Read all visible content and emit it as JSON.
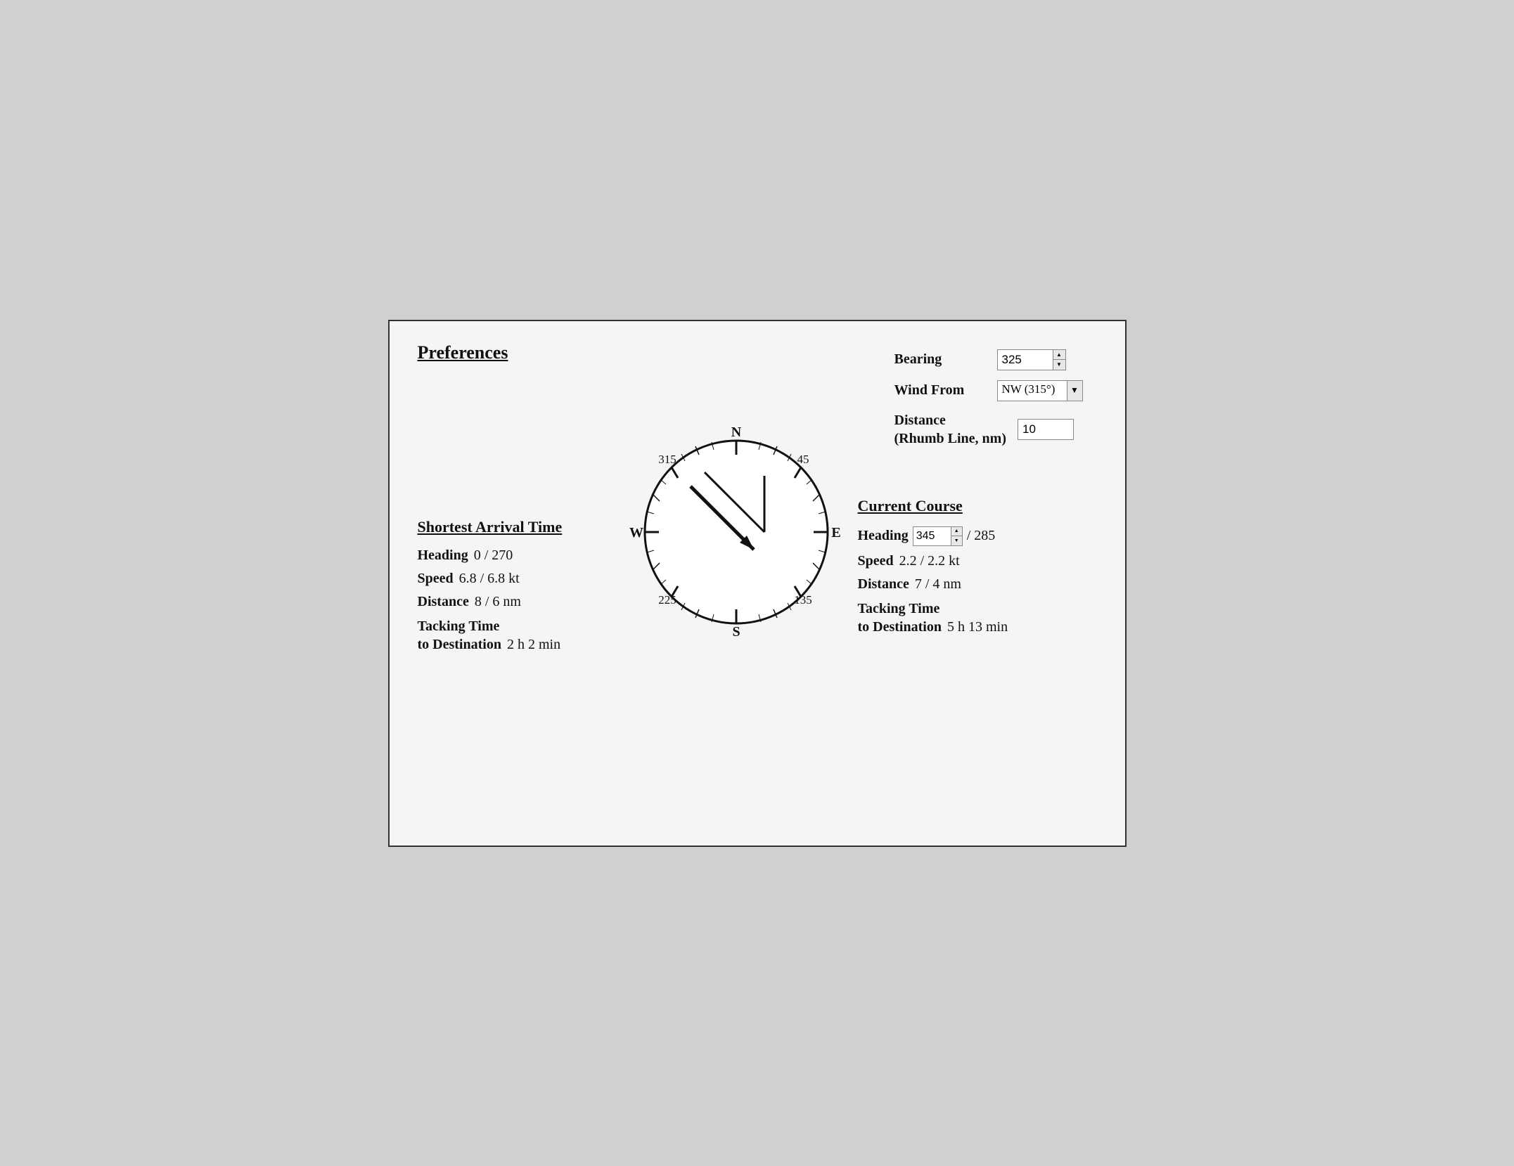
{
  "title": "Preferences",
  "controls": {
    "bearing_label": "Bearing",
    "bearing_value": "325",
    "wind_from_label": "Wind From",
    "wind_from_value": "NW (315°)",
    "distance_label": "Distance\n(Rhumb Line, nm)",
    "distance_label_line1": "Distance",
    "distance_label_line2": "(Rhumb Line, nm)",
    "distance_value": "10"
  },
  "compass": {
    "N": "N",
    "S": "S",
    "E": "E",
    "W": "W",
    "label_315": "315",
    "label_45": "45",
    "label_135": "135",
    "label_225": "225"
  },
  "shortest": {
    "title": "Shortest Arrival Time",
    "heading_label": "Heading",
    "heading_value": "0 / 270",
    "speed_label": "Speed",
    "speed_value": "6.8 / 6.8 kt",
    "distance_label": "Distance",
    "distance_value": "8 / 6 nm",
    "tacking_line1": "Tacking Time",
    "tacking_line2": "to Destination",
    "tacking_value": "2 h 2 min"
  },
  "current": {
    "title": "Current Course",
    "heading_label": "Heading",
    "heading_spin_value": "345",
    "heading_value": "/ 285",
    "speed_label": "Speed",
    "speed_value": "2.2 / 2.2 kt",
    "distance_label": "Distance",
    "distance_value": "7 / 4 nm",
    "tacking_line1": "Tacking Time",
    "tacking_line2": "to Destination",
    "tacking_value": "5 h 13 min"
  }
}
